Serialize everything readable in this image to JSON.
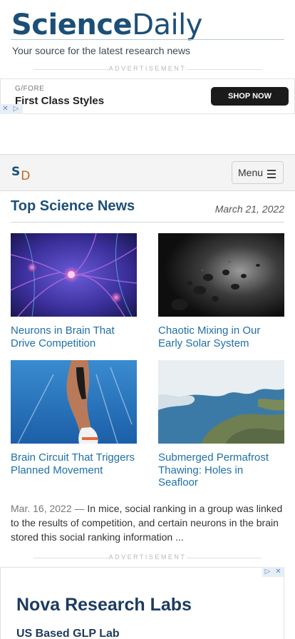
{
  "header": {
    "logo_part1": "Science",
    "logo_part2": "Daily",
    "tagline": "Your source for the latest research news"
  },
  "ads": {
    "label": "ADVERTISEMENT",
    "banner": {
      "brand": "G/FORE",
      "headline": "First Class Styles",
      "cta": "SHOP NOW",
      "close_glyph": "✕",
      "info_glyph": "▷"
    },
    "bottom": {
      "headline": "Nova Research Labs",
      "subline": "US Based GLP Lab",
      "close_glyph": "✕",
      "info_glyph": "▷"
    }
  },
  "nav": {
    "logo_s": "S",
    "logo_d": "D",
    "menu_label": "Menu"
  },
  "section": {
    "title": "Top Science News",
    "date": "March 21, 2022"
  },
  "stories": [
    {
      "title": "Neurons in Brain That Drive Competition",
      "image": "neurons-illustration"
    },
    {
      "title": "Chaotic Mixing in Our Early Solar System",
      "image": "asteroids-illustration"
    },
    {
      "title": "Brain Circuit That Triggers Planned Movement",
      "image": "sprinter-start-photo"
    },
    {
      "title": "Submerged Permafrost Thawing: Holes in Seafloor",
      "image": "arctic-satellite-map"
    }
  ],
  "summary": {
    "date": "Mar. 16, 2022",
    "separator": " — ",
    "text": "In mice, social ranking in a group was linked to the results of competition, and certain neurons in the brain stored this social ranking information ..."
  },
  "colors": {
    "brand_blue": "#1c4f77",
    "link_blue": "#1f6fa8",
    "accent_orange": "#c2661c"
  }
}
